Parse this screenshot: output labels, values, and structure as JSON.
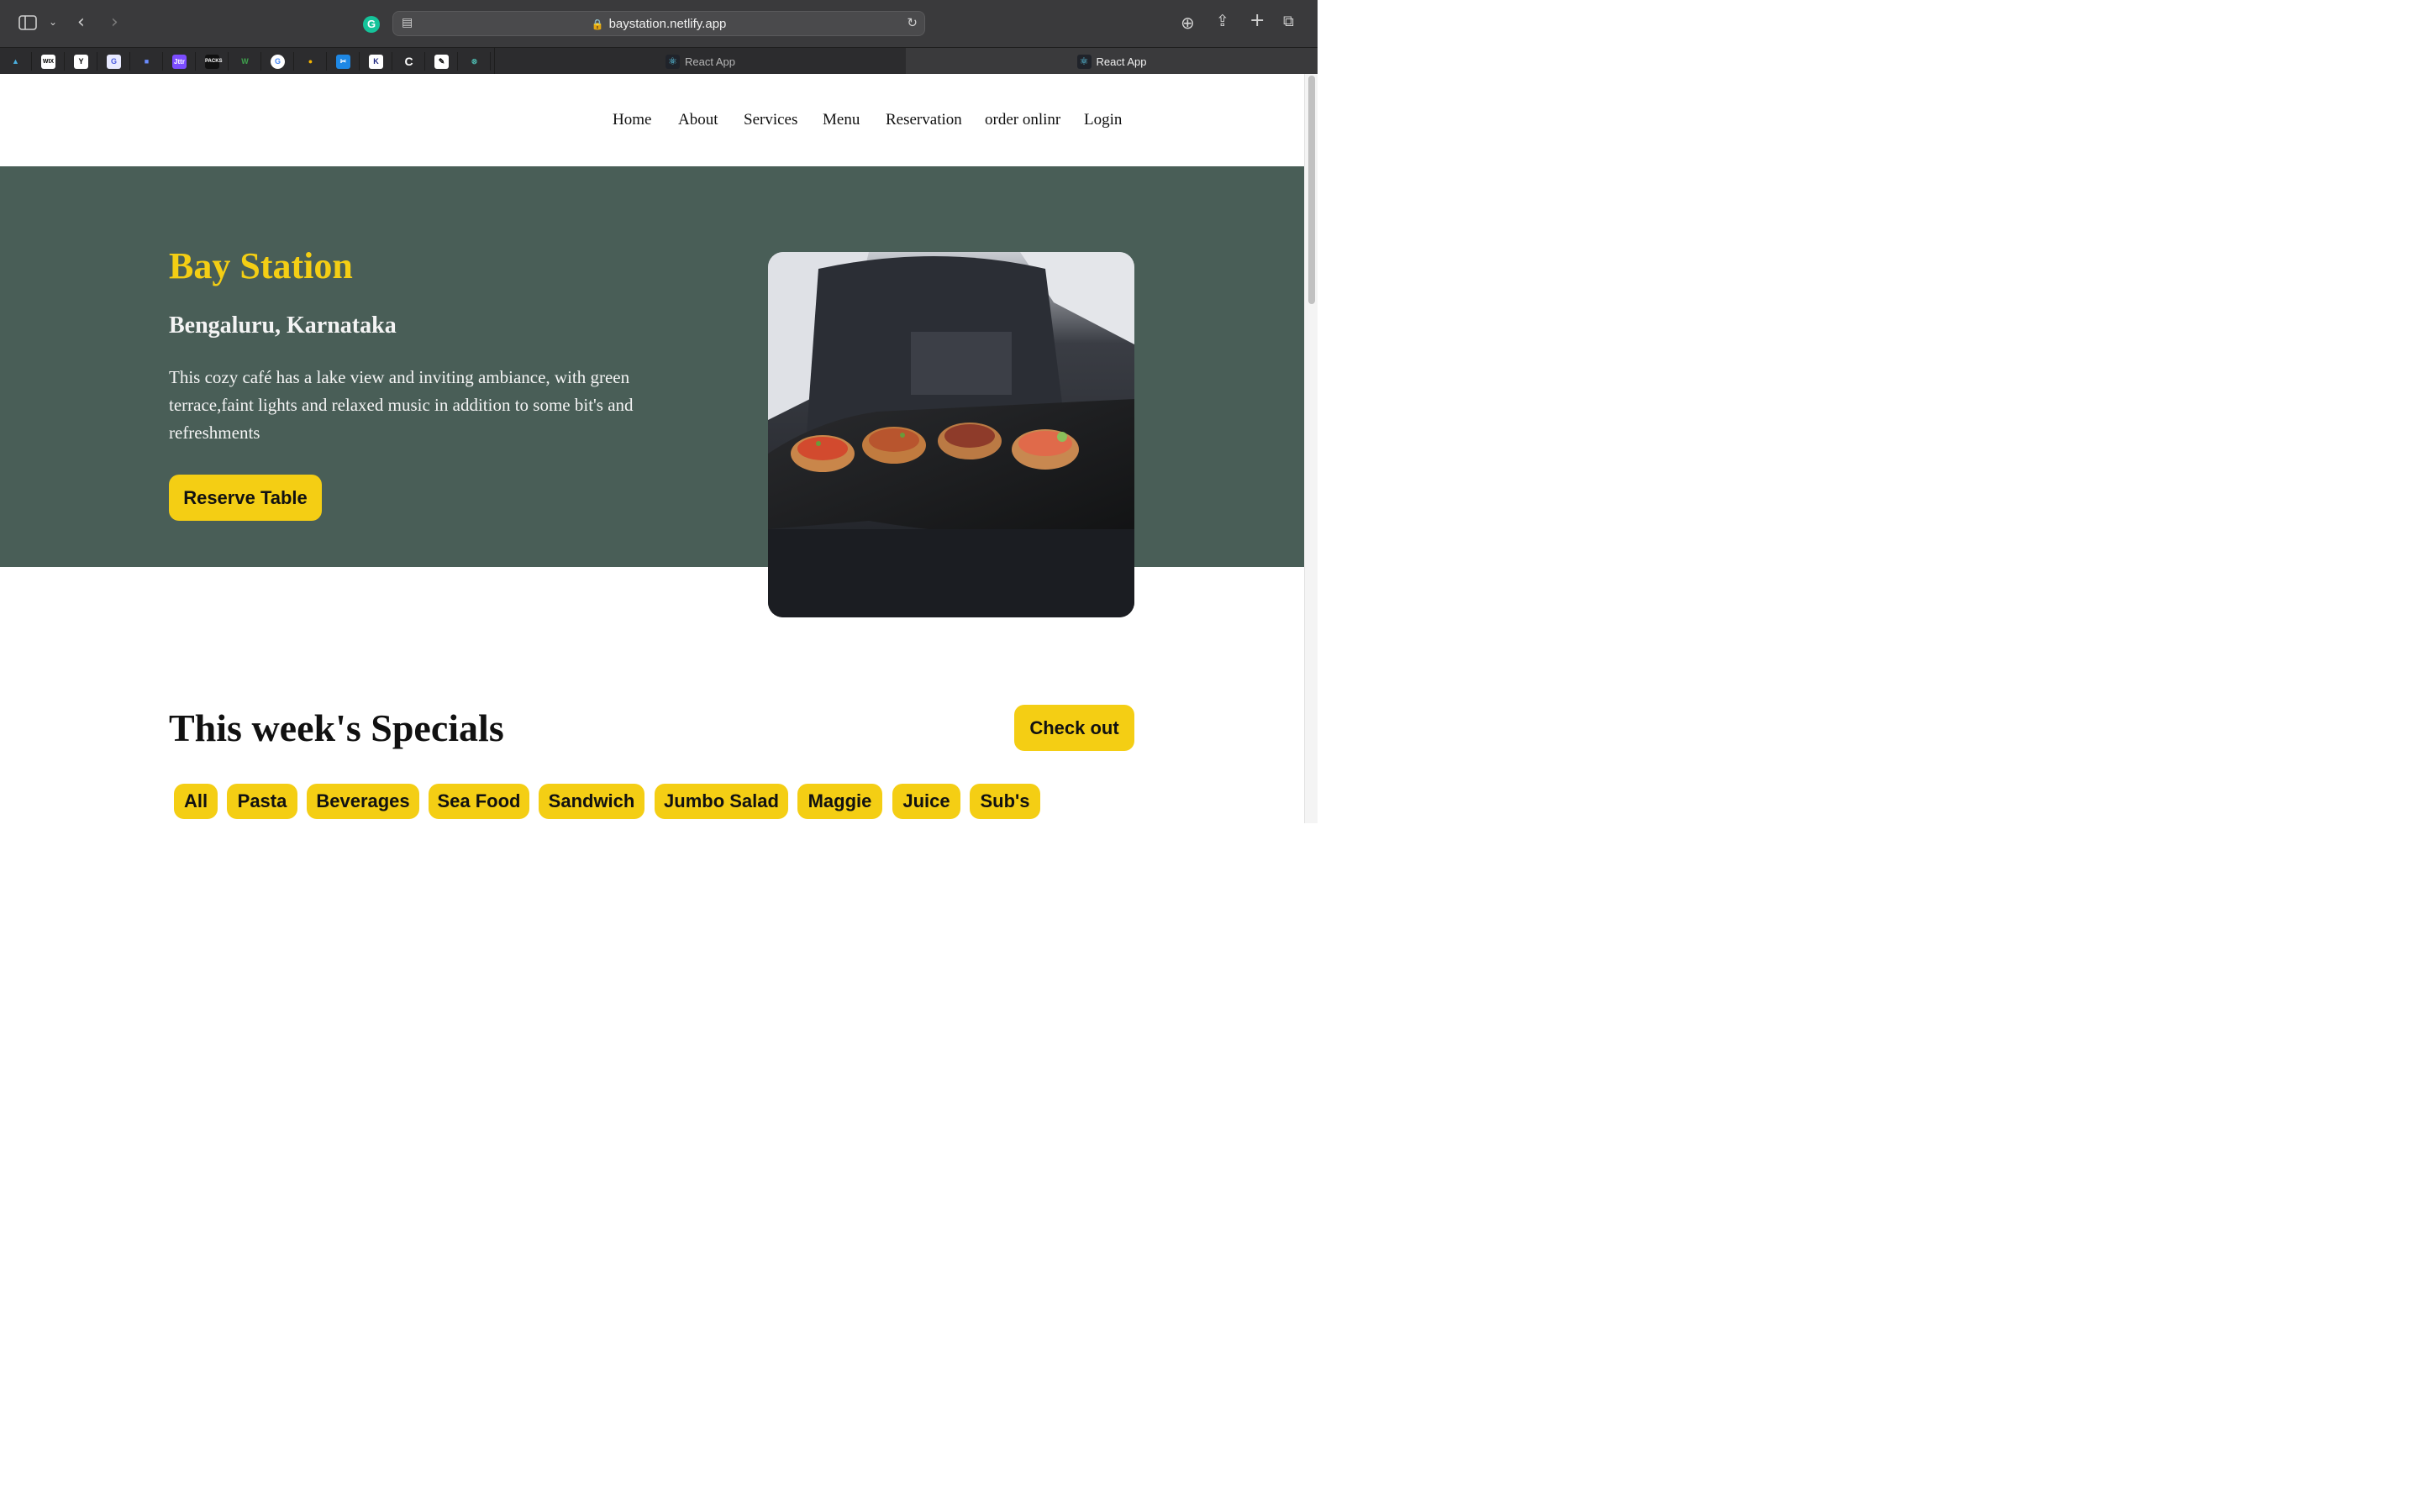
{
  "browser": {
    "url": "baystation.netlify.app",
    "tabs": [
      {
        "title": "React App"
      },
      {
        "title": "React App"
      }
    ],
    "favorites": [
      "favorite-1",
      "favorite-wix",
      "favorite-3",
      "favorite-4",
      "favorite-5",
      "favorite-jttr",
      "favorite-7",
      "favorite-8",
      "favorite-google",
      "favorite-10",
      "favorite-11",
      "favorite-12",
      "favorite-13",
      "favorite-14",
      "favorite-15"
    ]
  },
  "nav": {
    "items": [
      "Home",
      "About",
      "Services",
      "Menu",
      "Reservation",
      "order onlinr",
      "Login"
    ]
  },
  "hero": {
    "title": "Bay Station",
    "subtitle": "Bengaluru, Karnataka",
    "description": "This cozy café has a lake view and inviting ambiance, with green terrace,faint lights and relaxed music in addition to some bit's and refreshments",
    "button": "Reserve Table"
  },
  "specials": {
    "title": "This week's Specials",
    "button": "Check out",
    "categories": [
      "All",
      "Pasta",
      "Beverages",
      "Sea Food",
      "Sandwich",
      "Jumbo Salad",
      "Maggie",
      "Juice",
      "Sub's"
    ]
  },
  "colors": {
    "primary_green": "#495e57",
    "primary_yellow": "#f4ce14"
  }
}
